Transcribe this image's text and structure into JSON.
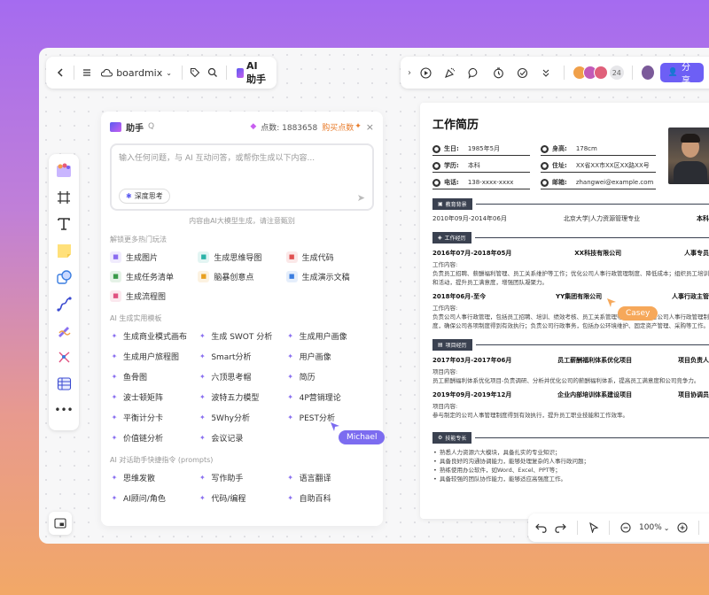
{
  "toolbar_left": {
    "brand": "boardmix",
    "ai_label": "AI助手"
  },
  "toolbar_right": {
    "collab_count": "24",
    "share_label": "分享"
  },
  "ai_panel": {
    "title": "助手",
    "points_label": "点数: 1883658",
    "buy_label": "购买点数",
    "placeholder": "输入任何问题，与 AI 互动问答，或帮你生成以下内容...",
    "deep_think": "深度思考",
    "disclaimer": "内容由AI大模型生成，请注意甄别",
    "section_hot": "解锁更多热门玩法",
    "hot_items": [
      {
        "label": "生成图片",
        "color": "#8b6cf0"
      },
      {
        "label": "生成思维导图",
        "color": "#2ab3a8"
      },
      {
        "label": "生成代码",
        "color": "#e05050"
      },
      {
        "label": "生成任务清单",
        "color": "#3a9a4a"
      },
      {
        "label": "脑暴创意点",
        "color": "#e8a020"
      },
      {
        "label": "生成演示文稿",
        "color": "#3a7de0"
      },
      {
        "label": "生成流程图",
        "color": "#e05080"
      }
    ],
    "section_templates": "AI 生成实用模板",
    "templates": [
      "生成商业模式画布",
      "生成 SWOT 分析",
      "生成用户画像",
      "生成用户旅程图",
      "Smart分析",
      "用户画像",
      "鱼骨图",
      "六顶思考帽",
      "简历",
      "波士顿矩阵",
      "波特五力模型",
      "4P营销理论",
      "平衡计分卡",
      "5Why分析",
      "PEST分析",
      "价值链分析",
      "会议记录"
    ],
    "section_prompts": "AI 对话助手快捷指令 (prompts)",
    "prompts": [
      "思维发散",
      "写作助手",
      "语言翻译",
      "AI顾问/角色",
      "代码/编程",
      "自助百科"
    ]
  },
  "resume": {
    "title": "工作简历",
    "info": [
      {
        "k": "生日:",
        "v": "1985年5月"
      },
      {
        "k": "身高:",
        "v": "178cm"
      },
      {
        "k": "学历:",
        "v": "本科"
      },
      {
        "k": "住址:",
        "v": "XX省XX市XX区XX路XX号"
      },
      {
        "k": "电话:",
        "v": "138-xxxx-xxxx"
      },
      {
        "k": "邮箱:",
        "v": "zhangwei@example.com"
      }
    ],
    "edu_title": "教育背景",
    "edu_line": {
      "date": "2010年09月-2014年06月",
      "school": "北京大学|人力资源管理专业",
      "degree": "本科"
    },
    "work_title": "工作经历",
    "jobs": [
      {
        "date": "2016年07月-2018年05月",
        "company": "XX科技有限公司",
        "role": "人事专员",
        "heading": "工作内容:",
        "text": "负责员工招聘、薪酬福利管理、员工关系维护等工作；优化公司人事行政管理制度、降低成本；组织员工培训和活动，提升员工满意度，增强团队凝聚力。"
      },
      {
        "date": "2018年06月-至今",
        "company": "YY集团有限公司",
        "role": "人事行政主管",
        "heading": "工作内容:",
        "text": "负责公司人事行政管理，包括员工招聘、培训、绩效考核、员工关系管理等；制定和完善公司人事行政管理制度，确保公司各项制度得到有效执行；负责公司行政事务，包括办公环境维护、固定资产管理、采购等工作。"
      }
    ],
    "project_title": "项目经历",
    "projects": [
      {
        "date": "2017年03月-2017年06月",
        "name": "员工薪酬福利体系优化项目",
        "role": "项目负责人",
        "heading": "项目内容:",
        "text": "员工薪酬福利体系优化项目-负责调研、分析并优化公司的薪酬福利体系，提高员工满意度和公司竞争力。"
      },
      {
        "date": "2019年09月-2019年12月",
        "name": "企业内部培训体系建设项目",
        "role": "项目协调员",
        "heading": "项目内容:",
        "text": "参与制定的公司人事管理制度得到有效执行，提升员工职业技能和工作效率。"
      }
    ],
    "skills_title": "技能专长",
    "skills": [
      "熟悉人力资源六大模块，具备扎实的专业知识；",
      "具备良好的沟通协调能力，能够处理复杂的人事行政问题；",
      "熟练使用办公软件，如Word、Excel、PPT等；",
      "具备较强的团队协作能力，能够适应高强度工作。"
    ]
  },
  "cursors": {
    "casey": "Casey",
    "michael": "Michael"
  },
  "bottom_toolbar": {
    "zoom": "100%"
  }
}
